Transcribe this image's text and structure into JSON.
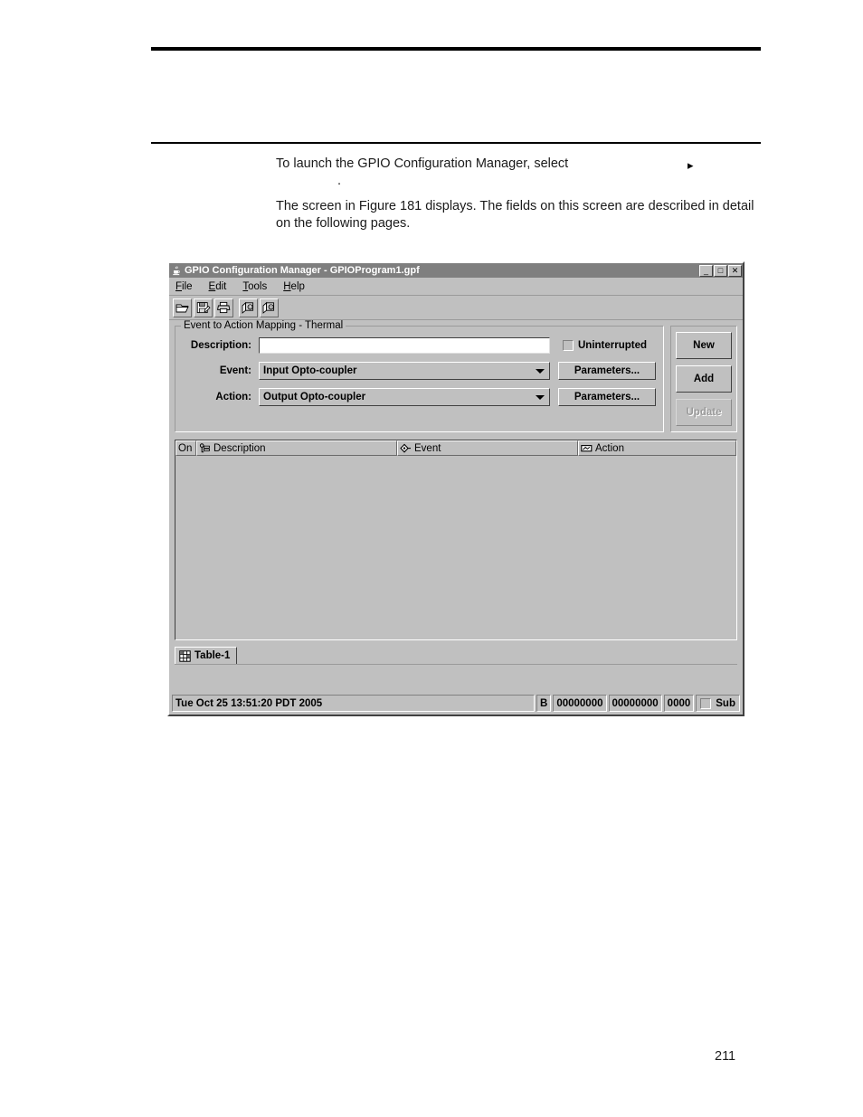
{
  "document": {
    "paragraph_launch": "To launch the GPIO Configuration Manager, select",
    "launch_arrow_glyph": "▸",
    "paragraph_dot": ".",
    "paragraph_figure": "The screen in Figure 181 displays. The fields on this screen are described in detail on the following pages.",
    "page_number": "211"
  },
  "window": {
    "title": "GPIO Configuration Manager - GPIOProgram1.gpf",
    "app_icon": "java-cup-icon",
    "controls": {
      "minimize": "_",
      "maximize": "□",
      "close": "✕"
    },
    "menus": [
      {
        "mnemonic": "F",
        "rest": "ile"
      },
      {
        "mnemonic": "E",
        "rest": "dit"
      },
      {
        "mnemonic": "T",
        "rest": "ools"
      },
      {
        "mnemonic": "H",
        "rest": "elp"
      }
    ],
    "toolbar": [
      {
        "name": "open-file-icon"
      },
      {
        "name": "save-file-icon"
      },
      {
        "name": "print-icon"
      },
      {
        "name": "upload-icon"
      },
      {
        "name": "download-icon"
      }
    ]
  },
  "form": {
    "group_title": "Event to Action Mapping - Thermal",
    "description_label": "Description:",
    "description_value": "",
    "description_placeholder": "",
    "uninterrupted_label": "Uninterrupted",
    "uninterrupted_checked": false,
    "event_label": "Event:",
    "event_value": "Input Opto-coupler",
    "action_label": "Action:",
    "action_value": "Output Opto-coupler",
    "event_params_label": "Parameters...",
    "action_params_label": "Parameters..."
  },
  "side_buttons": {
    "new_label": "New",
    "add_label": "Add",
    "update_label": "Update",
    "update_enabled": false
  },
  "table": {
    "columns": [
      {
        "label": "On",
        "icon": null
      },
      {
        "label": "Description",
        "icon": "tag-icon"
      },
      {
        "label": "Event",
        "icon": "diamond-icon"
      },
      {
        "label": "Action",
        "icon": "action-box-icon"
      }
    ],
    "rows": []
  },
  "tabs": [
    {
      "label": "Table-1",
      "icon": "table-grid-icon",
      "active": true
    }
  ],
  "status_bar": {
    "date": "Tue Oct 25 13:51:20 PDT 2005",
    "mode": "B",
    "field1": "00000000",
    "field2": "00000000",
    "field3": "0000",
    "sub_label": "Sub",
    "sub_checked": false
  },
  "colors": {
    "window_face": "#c0c0c0",
    "title_bar": "#7f7f7f",
    "title_text": "#ffffff",
    "field_background": "#ffffff",
    "disabled_text": "#9a9a9a"
  }
}
